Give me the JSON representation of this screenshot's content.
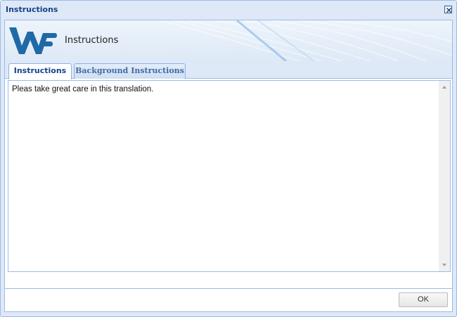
{
  "window": {
    "title": "Instructions",
    "close_icon": "close-icon"
  },
  "header": {
    "logo": "wf-logo",
    "title": "Instructions"
  },
  "tabs": [
    {
      "label": "Instructions",
      "active": true
    },
    {
      "label": "Background Instructions",
      "active": false
    }
  ],
  "content": {
    "text": "Pleas take great care in this translation."
  },
  "footer": {
    "ok_label": "OK"
  },
  "colors": {
    "title_text": "#15428b",
    "border": "#99bbe8",
    "frame_bg": "#dfe8f6",
    "logo_blue": "#1f6aa6"
  }
}
